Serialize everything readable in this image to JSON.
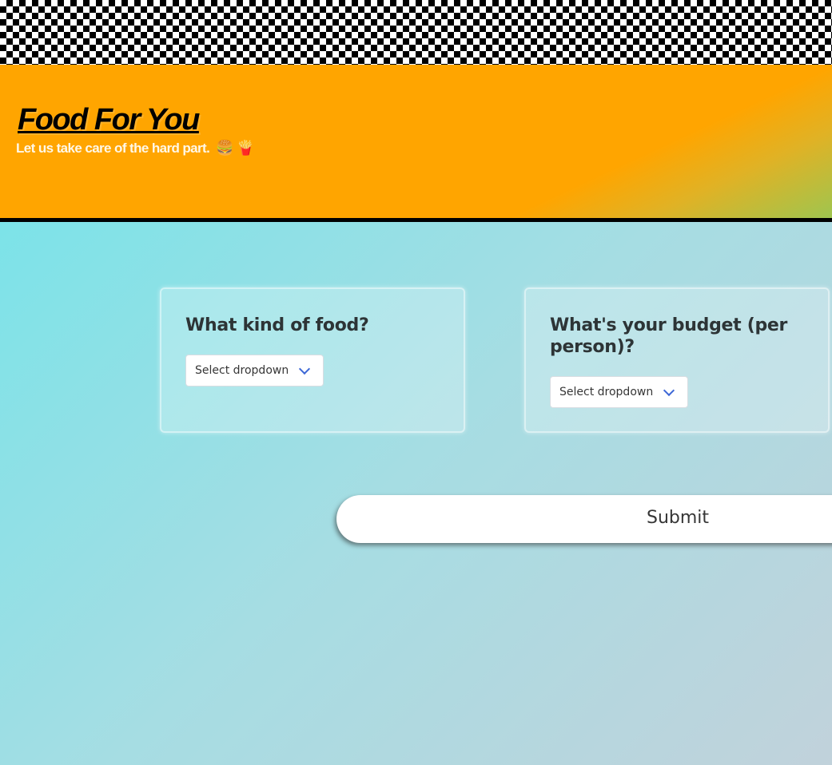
{
  "header": {
    "title": "Food For You",
    "tagline": "Let us take care of the hard part.",
    "emojis": [
      "🍔",
      "🍟"
    ]
  },
  "form": {
    "food": {
      "question": "What kind of food?",
      "dropdown_value": "Select dropdown"
    },
    "budget": {
      "question": "What's your budget (per person)?",
      "dropdown_value": "Select dropdown"
    },
    "submit_label": "Submit"
  },
  "colors": {
    "header_bg": "#ffa500",
    "background_start": "#6ee5ea",
    "background_end": "#c1d2db",
    "chevron": "#3e68d6"
  },
  "icons": {
    "dropdown_arrow": "chevron-down-icon"
  }
}
